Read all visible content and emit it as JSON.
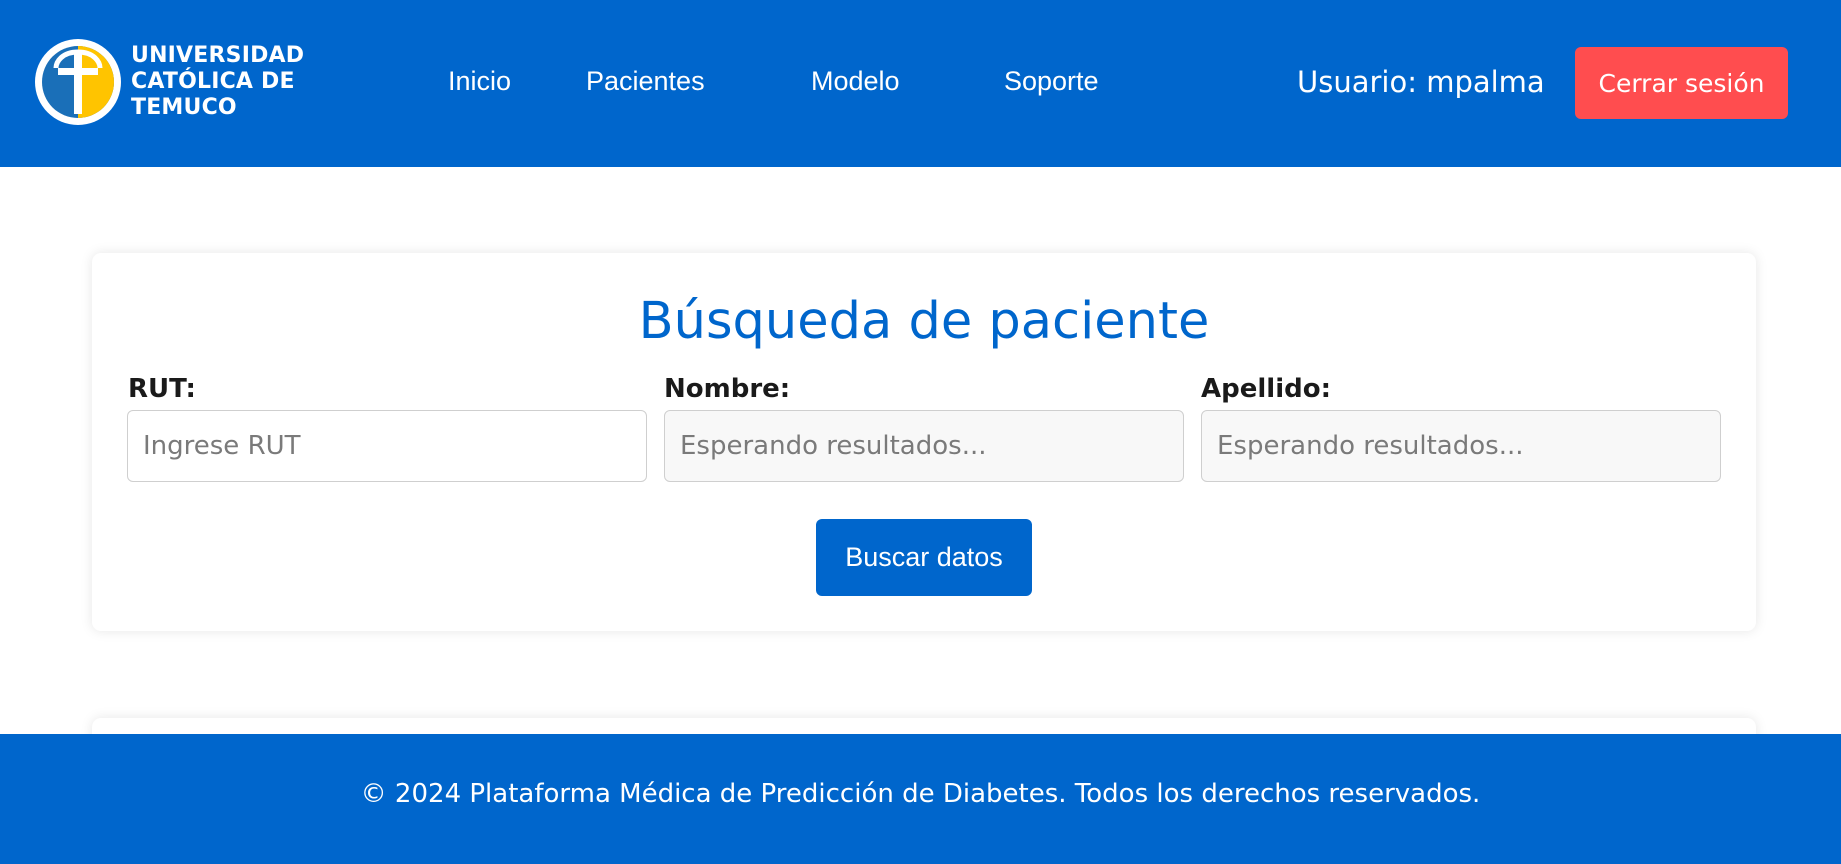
{
  "brand": {
    "logo_lines": [
      "UNIVERSIDAD",
      "CATÓLICA DE",
      "TEMUCO"
    ],
    "logo_icon": "cross-circle-logo-icon"
  },
  "nav": {
    "links": [
      "Inicio",
      "Pacientes",
      "Modelo",
      "Soporte"
    ],
    "user_label": "Usuario: mpalma",
    "logout_label": "Cerrar sesión"
  },
  "search": {
    "title": "Búsqueda de paciente",
    "fields": [
      {
        "label": "RUT:",
        "placeholder": "Ingrese RUT",
        "value": ""
      },
      {
        "label": "Nombre:",
        "placeholder": "Esperando resultados...",
        "value": ""
      },
      {
        "label": "Apellido:",
        "placeholder": "Esperando resultados...",
        "value": ""
      }
    ],
    "button_label": "Buscar datos"
  },
  "footer": {
    "text": "© 2024 Plataforma Médica de Predicción de Diabetes. Todos los derechos reservados."
  },
  "colors": {
    "primary": "#0066cc",
    "danger": "#ff4d4f",
    "background": "#ffffff"
  }
}
